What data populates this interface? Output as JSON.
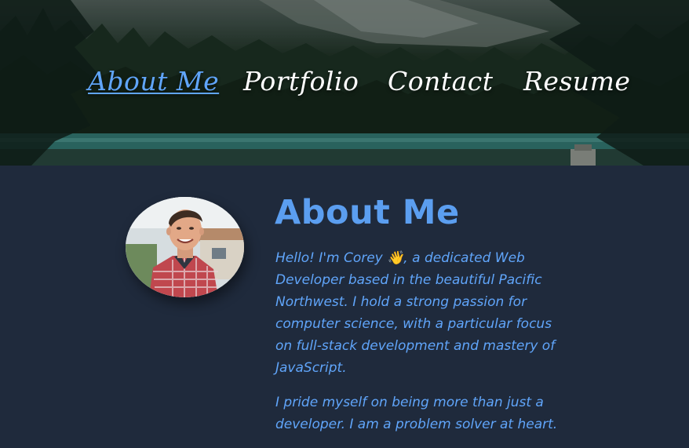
{
  "nav": {
    "items": [
      {
        "label": "About Me",
        "active": true
      },
      {
        "label": "Portfolio",
        "active": false
      },
      {
        "label": "Contact",
        "active": false
      },
      {
        "label": "Resume",
        "active": false
      }
    ]
  },
  "about": {
    "title": "About Me",
    "paragraphs": [
      "Hello! I'm Corey 👋, a dedicated Web Developer based in the beautiful Pacific Northwest. I hold a strong passion for computer science, with a particular focus on full-stack development and mastery of JavaScript.",
      "I pride myself on being more than just a developer. I am a problem solver at heart."
    ]
  },
  "colors": {
    "accent": "#60a5fa",
    "page_background": "#1f2a3c",
    "nav_text": "#ffffff"
  },
  "icons": {
    "waving_hand": "waving-hand-emoji"
  }
}
